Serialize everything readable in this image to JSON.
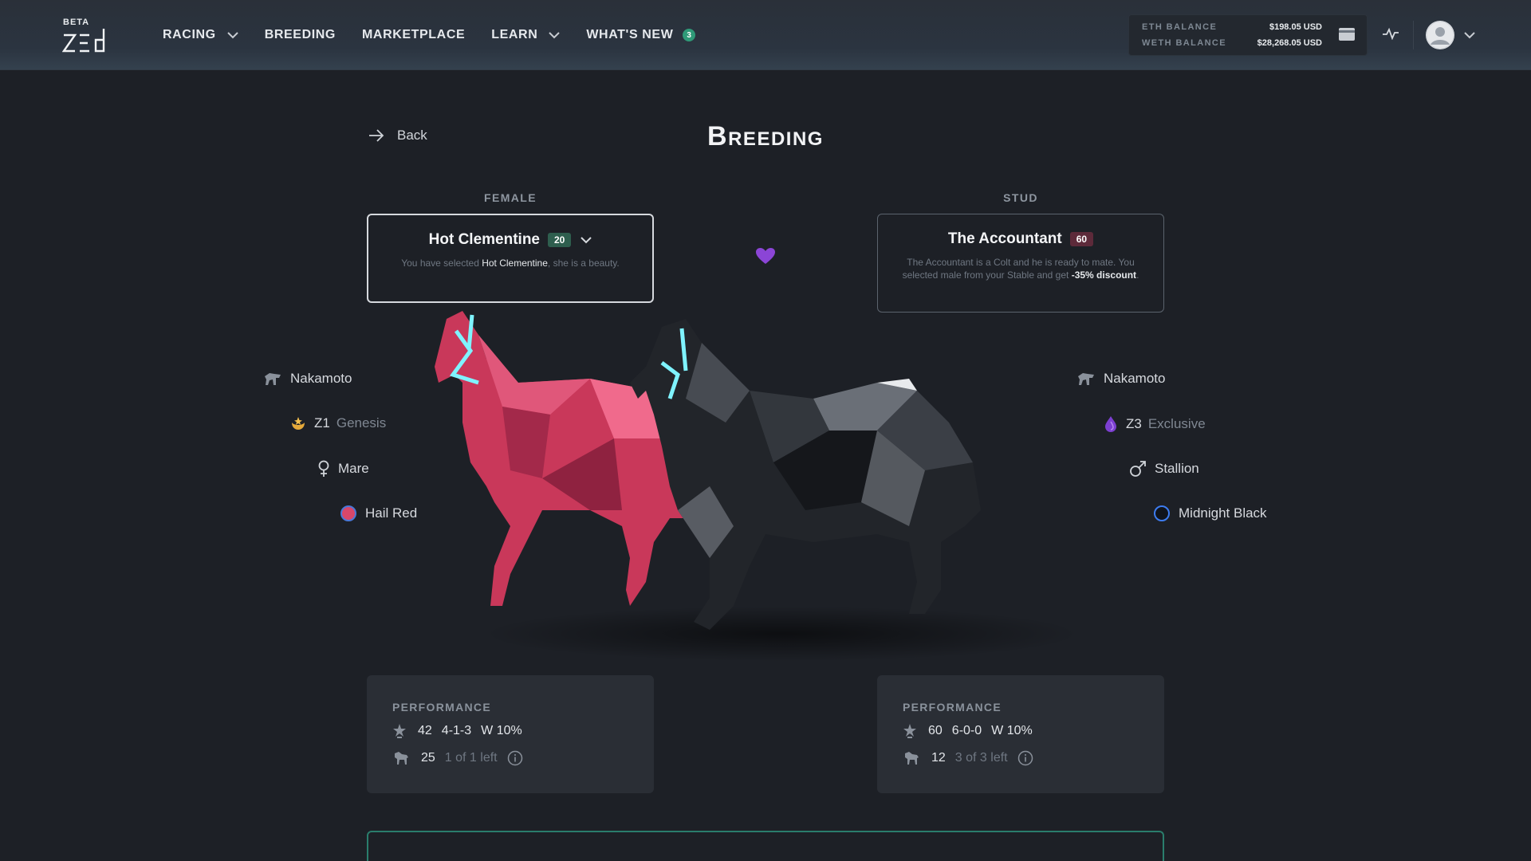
{
  "header": {
    "logo_beta": "BETA",
    "nav": [
      {
        "label": "RACING",
        "has_chevron": true
      },
      {
        "label": "BREEDING",
        "has_chevron": false
      },
      {
        "label": "MARKETPLACE",
        "has_chevron": false
      },
      {
        "label": "LEARN",
        "has_chevron": true
      },
      {
        "label": "WHAT'S NEW",
        "badge": "3"
      }
    ],
    "balances": {
      "eth_label": "ETH BALANCE",
      "eth_value": "$198.05 USD",
      "weth_label": "WETH BALANCE",
      "weth_value": "$28,268.05 USD"
    },
    "icons": [
      "wallet-icon",
      "pulse-icon",
      "avatar",
      "chevron-down-icon"
    ]
  },
  "page": {
    "back_label": "Back",
    "title": "Breeding"
  },
  "female": {
    "section_label": "FEMALE",
    "name": "Hot Clementine",
    "level": "20",
    "desc_prefix": "You have selected ",
    "desc_name": "Hot Clementine",
    "desc_suffix": ", she is a beauty.",
    "bloodline": "Nakamoto",
    "zed_code": "Z1",
    "zed_type": "Genesis",
    "gender": "Mare",
    "coat": "Hail Red",
    "coat_color": "#d8476a",
    "performance": {
      "title": "PERFORMANCE",
      "races": "42",
      "record": "4-1-3",
      "win_rate": "W 10%",
      "offspring": "25",
      "offspring_left": "1 of 1 left"
    }
  },
  "stud": {
    "section_label": "STUD",
    "name": "The Accountant",
    "level": "60",
    "desc_text": "The Accountant is a Colt and he is ready to mate. You selected male from your Stable and get ",
    "desc_discount": "-35% discount",
    "desc_end": ".",
    "bloodline": "Nakamoto",
    "zed_code": "Z3",
    "zed_type": "Exclusive",
    "gender": "Stallion",
    "coat": "Midnight Black",
    "coat_color": "#10141c",
    "performance": {
      "title": "PERFORMANCE",
      "races": "60",
      "record": "6-0-0",
      "win_rate": "W 10%",
      "offspring": "12",
      "offspring_left": "3 of 3 left"
    }
  },
  "colors": {
    "accent_green": "#2f9a78",
    "heart": "#8b45d6",
    "halter_glow": "#7ff3ff"
  }
}
